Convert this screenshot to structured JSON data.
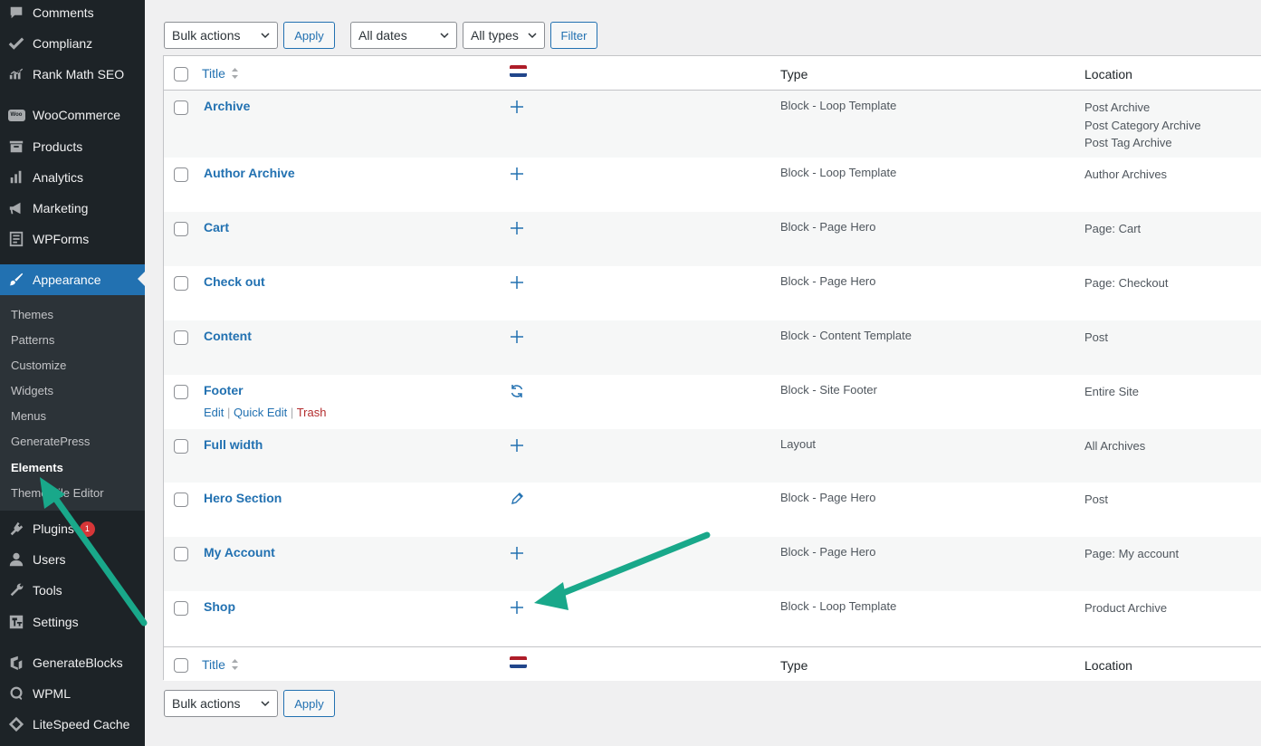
{
  "sidebar": {
    "items_top": [
      {
        "label": "Comments",
        "icon": "comment-icon"
      },
      {
        "label": "Complianz",
        "icon": "check-icon"
      },
      {
        "label": "Rank Math SEO",
        "icon": "chart-icon"
      },
      {
        "label": "WooCommerce",
        "icon": "woo-icon",
        "icon_text": "Woo"
      },
      {
        "label": "Products",
        "icon": "archive-icon"
      },
      {
        "label": "Analytics",
        "icon": "bar-chart-icon"
      },
      {
        "label": "Marketing",
        "icon": "megaphone-icon"
      },
      {
        "label": "WPForms",
        "icon": "form-icon"
      }
    ],
    "active_item": {
      "label": "Appearance",
      "icon": "paintbrush-icon"
    },
    "submenu": [
      {
        "label": "Themes"
      },
      {
        "label": "Patterns"
      },
      {
        "label": "Customize"
      },
      {
        "label": "Widgets"
      },
      {
        "label": "Menus"
      },
      {
        "label": "GeneratePress"
      },
      {
        "label": "Elements",
        "current": true
      },
      {
        "label": "Theme File Editor"
      }
    ],
    "items_bottom": [
      {
        "label": "Plugins",
        "icon": "plugin-icon",
        "badge": "1"
      },
      {
        "label": "Users",
        "icon": "user-icon"
      },
      {
        "label": "Tools",
        "icon": "wrench-icon"
      },
      {
        "label": "Settings",
        "icon": "settings-icon"
      },
      {
        "label": "GenerateBlocks",
        "icon": "generateblocks-icon"
      },
      {
        "label": "WPML",
        "icon": "wpml-icon"
      },
      {
        "label": "LiteSpeed Cache",
        "icon": "diamond-icon"
      }
    ]
  },
  "toolbar_top": {
    "bulk_actions": "Bulk actions",
    "apply": "Apply",
    "dates": "All dates",
    "types": "All types",
    "filter": "Filter"
  },
  "toolbar_bottom": {
    "bulk_actions": "Bulk actions",
    "apply": "Apply"
  },
  "table": {
    "columns": {
      "title": "Title",
      "type": "Type",
      "location": "Location"
    },
    "flag_colors": [
      "#ae1c28",
      "#ffffff",
      "#21468b"
    ],
    "rows": [
      {
        "title": "Archive",
        "status_icon": "plus-icon",
        "type": "Block - Loop Template",
        "location": [
          "Post Archive",
          "Post Category Archive",
          "Post Tag Archive"
        ]
      },
      {
        "title": "Author Archive",
        "status_icon": "plus-icon",
        "type": "Block - Loop Template",
        "location": [
          "Author Archives"
        ]
      },
      {
        "title": "Cart",
        "status_icon": "plus-icon",
        "type": "Block - Page Hero",
        "location": [
          "Page: Cart"
        ]
      },
      {
        "title": "Check out",
        "status_icon": "plus-icon",
        "type": "Block - Page Hero",
        "location": [
          "Page: Checkout"
        ]
      },
      {
        "title": "Content",
        "status_icon": "plus-icon",
        "type": "Block - Content Template",
        "location": [
          "Post"
        ]
      },
      {
        "title": "Footer",
        "status_icon": "refresh-icon",
        "type": "Block - Site Footer",
        "location": [
          "Entire Site"
        ],
        "row_actions": {
          "edit": "Edit",
          "quick_edit": "Quick Edit",
          "trash": "Trash",
          "sep": "|"
        }
      },
      {
        "title": "Full width",
        "status_icon": "plus-icon",
        "type": "Layout",
        "location": [
          "All Archives"
        ]
      },
      {
        "title": "Hero Section",
        "status_icon": "pencil-icon",
        "type": "Block - Page Hero",
        "location": [
          "Post"
        ]
      },
      {
        "title": "My Account",
        "status_icon": "plus-icon",
        "type": "Block - Page Hero",
        "location": [
          "Page: My account"
        ]
      },
      {
        "title": "Shop",
        "status_icon": "plus-icon",
        "type": "Block - Loop Template",
        "location": [
          "Product Archive"
        ]
      }
    ]
  },
  "annotation_color": "#19a88a"
}
